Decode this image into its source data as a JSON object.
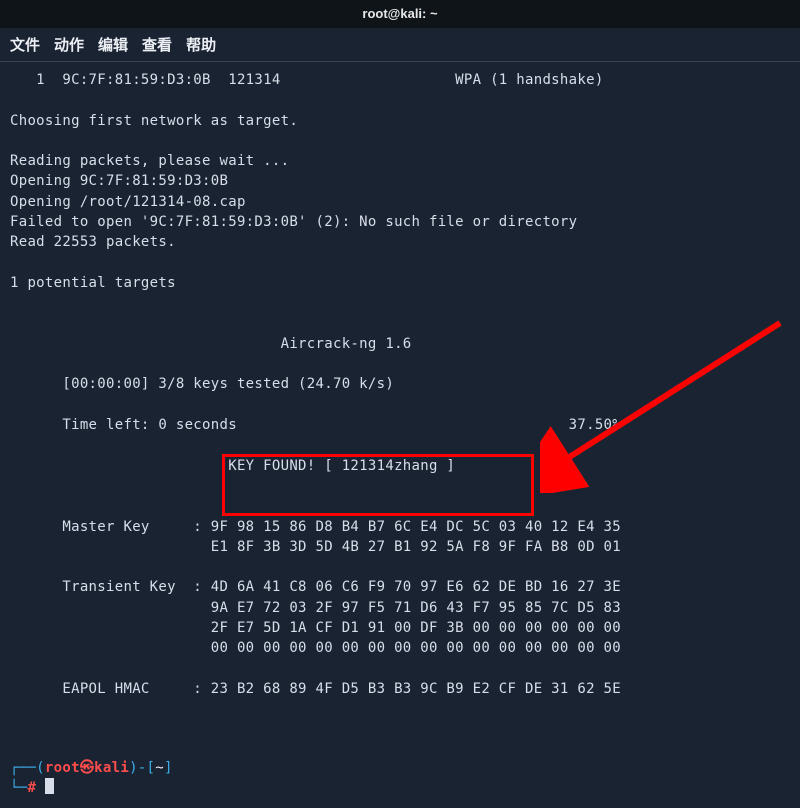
{
  "titlebar": {
    "text": "root@kali: ~"
  },
  "menu": {
    "file": "文件",
    "actions": "动作",
    "edit": "编辑",
    "view": "查看",
    "help": "帮助"
  },
  "lines": {
    "l1": "   1  9C:7F:81:59:D3:0B  121314                    WPA (1 handshake)",
    "l2": "",
    "l3": "Choosing first network as target.",
    "l4": "",
    "l5": "Reading packets, please wait ...",
    "l6": "Opening 9C:7F:81:59:D3:0B",
    "l7": "Opening /root/121314-08.cap",
    "l8": "Failed to open '9C:7F:81:59:D3:0B' (2): No such file or directory",
    "l9": "Read 22553 packets.",
    "l10": "",
    "l11": "1 potential targets",
    "l12": "",
    "l13": "",
    "l14": "                               Aircrack-ng 1.6",
    "l15": "",
    "l16": "      [00:00:00] 3/8 keys tested (24.70 k/s)",
    "l17": "",
    "l18": "      Time left: 0 seconds                                      37.50%",
    "l19": "",
    "l20": "                         KEY FOUND! [ 121314zhang ]",
    "l21": "",
    "l22": "",
    "l23": "      Master Key     : 9F 98 15 86 D8 B4 B7 6C E4 DC 5C 03 40 12 E4 35",
    "l24": "                       E1 8F 3B 3D 5D 4B 27 B1 92 5A F8 9F FA B8 0D 01",
    "l25": "",
    "l26": "      Transient Key  : 4D 6A 41 C8 06 C6 F9 70 97 E6 62 DE BD 16 27 3E",
    "l27": "                       9A E7 72 03 2F 97 F5 71 D6 43 F7 95 85 7C D5 83",
    "l28": "                       2F E7 5D 1A CF D1 91 00 DF 3B 00 00 00 00 00 00",
    "l29": "                       00 00 00 00 00 00 00 00 00 00 00 00 00 00 00 00",
    "l30": "",
    "l31": "      EAPOL HMAC     : 23 B2 68 89 4F D5 B3 B3 9C B9 E2 CF DE 31 62 5E"
  },
  "prompt": {
    "open1": "┌──(",
    "user": "root",
    "at": "㉿",
    "host": "kali",
    "close1": ")-[",
    "cwd": "~",
    "close2": "]",
    "line2_open": "└─",
    "hash": "#"
  }
}
